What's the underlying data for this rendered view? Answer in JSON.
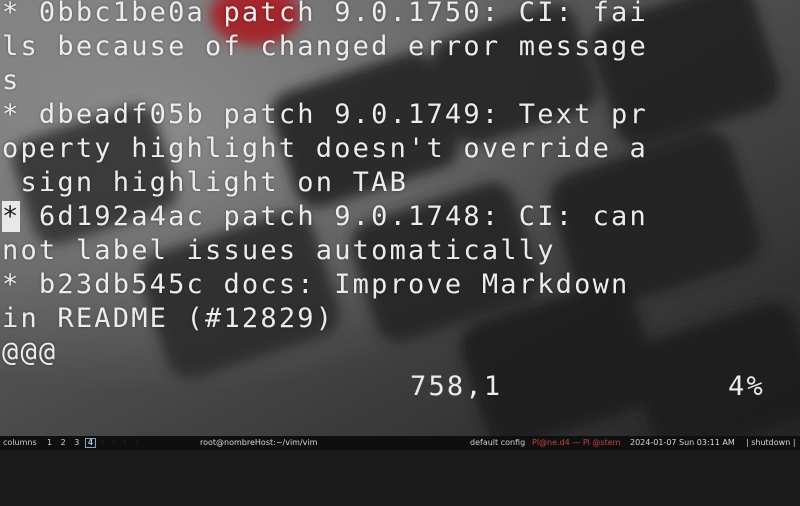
{
  "terminal": {
    "lines": [
      "* 0bbc1be0a patch 9.0.1750: CI: fai",
      "ls because of changed error message",
      "s",
      "* dbeadf05b patch 9.0.1749: Text pr",
      "operty highlight doesn't override a",
      " sign highlight on TAB",
      "6d192a4ac patch 9.0.1748: CI: can",
      "not label issues automatically",
      "* b23db545c docs: Improve Markdown",
      "in README (#12829)",
      "@@@"
    ],
    "cursor_char": "*",
    "cursor_gap": " ",
    "ruler_position": "758,1",
    "ruler_percent": "4%"
  },
  "statusbar": {
    "columns_label": "columns",
    "workspaces": [
      "1",
      "2",
      "3",
      "4"
    ],
    "active_workspace": "4",
    "extra_workspaces": [
      "·",
      "·",
      "·",
      "·"
    ],
    "window_title": "root@nombreHost:~/vim/vim",
    "config": "default config",
    "user_host": "Pl@ne.d4 — Pl @stem",
    "datetime": "2024-01-07 Sun 03:11 AM",
    "shutdown": "| shutdown |"
  },
  "colors": {
    "terminal_text": "#ececec",
    "cursor_bg": "#e8e8e8",
    "statusbar_bg": "#0f0f12",
    "statusbar_accent": "#c8463a",
    "wallpaper_red": "#c0222a"
  }
}
